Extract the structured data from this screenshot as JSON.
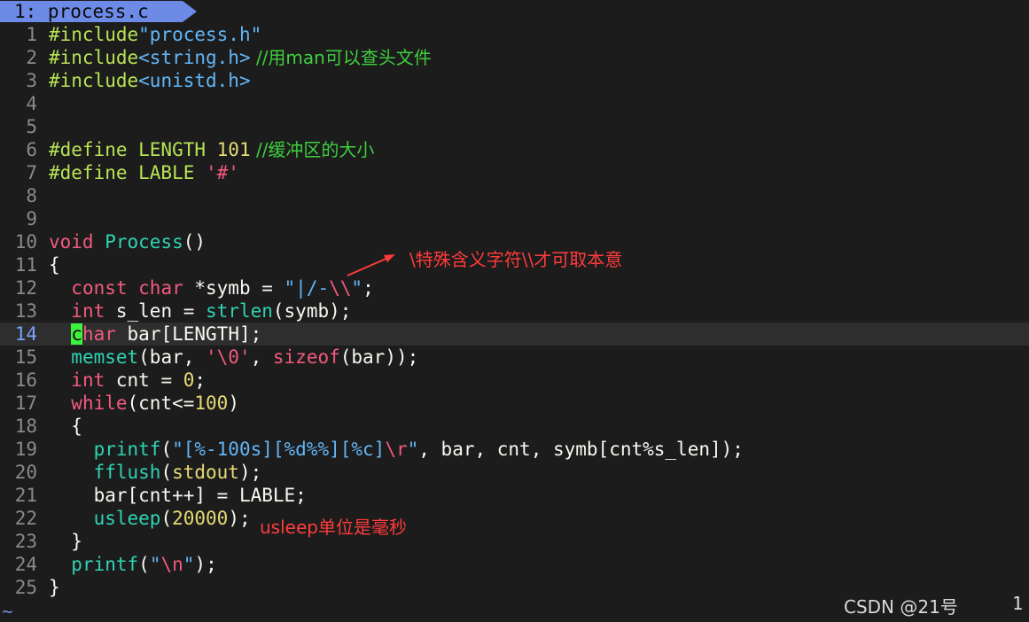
{
  "tab": {
    "label": "1: process.c"
  },
  "lines": [
    {
      "n": "1"
    },
    {
      "n": "2"
    },
    {
      "n": "3"
    },
    {
      "n": "4"
    },
    {
      "n": "5"
    },
    {
      "n": "6"
    },
    {
      "n": "7"
    },
    {
      "n": "8"
    },
    {
      "n": "9"
    },
    {
      "n": "10"
    },
    {
      "n": "11"
    },
    {
      "n": "12"
    },
    {
      "n": "13"
    },
    {
      "n": "14"
    },
    {
      "n": "15"
    },
    {
      "n": "16"
    },
    {
      "n": "17"
    },
    {
      "n": "18"
    },
    {
      "n": "19"
    },
    {
      "n": "20"
    },
    {
      "n": "21"
    },
    {
      "n": "22"
    },
    {
      "n": "23"
    },
    {
      "n": "24"
    },
    {
      "n": "25"
    }
  ],
  "code": {
    "l1_pp": "#include",
    "l1_str": "\"process.h\"",
    "l2_pp": "#include",
    "l2_str": "<string.h>",
    "l2_cm": " //用man可以查头文件",
    "l3_pp": "#include",
    "l3_str": "<unistd.h>",
    "l6_pp": "#define LENGTH ",
    "l6_num": "101",
    "l6_cm": " //缓冲区的大小",
    "l7_pp": "#define LABLE ",
    "l7_chr": "'#'",
    "l10_ty": "void",
    "l10_fn": "Process",
    "l10_rest": "()",
    "l11": "{",
    "l12_a": "const char",
    "l12_b": " *symb = ",
    "l12_s1": "\"|/-",
    "l12_esc": "\\\\",
    "l12_s2": "\"",
    "l12_c": ";",
    "l13_ty": "int",
    "l13_b": " s_len = ",
    "l13_fn": "strlen",
    "l13_c": "(symb);",
    "l14_cur": "c",
    "l14_ty": "har",
    "l14_b": " bar[LENGTH];",
    "l15_fn": "memset",
    "l15_b": "(bar, ",
    "l15_chr": "'\\0'",
    "l15_c": ", ",
    "l15_kw": "sizeof",
    "l15_d": "(bar));",
    "l16_ty": "int",
    "l16_b": " cnt = ",
    "l16_num": "0",
    "l16_c": ";",
    "l17_kw": "while",
    "l17_b": "(cnt<=",
    "l17_num": "100",
    "l17_c": ")",
    "l18": "{",
    "l19_fn": "printf",
    "l19_b": "(",
    "l19_s1": "\"[%-100s][%d%%][%c]",
    "l19_esc": "\\r",
    "l19_s2": "\"",
    "l19_c": ", bar, cnt, symb[cnt%s_len]);",
    "l20_fn": "fflush",
    "l20_b": "(",
    "l20_num": "stdout",
    "l20_c": ");",
    "l21": "bar[cnt++] = LABLE;",
    "l22_fn": "usleep",
    "l22_b": "(",
    "l22_num": "20000",
    "l22_c": ");",
    "l23": "}",
    "l24_fn": "printf",
    "l24_b": "(",
    "l24_s1": "\"",
    "l24_esc": "\\n",
    "l24_s2": "\"",
    "l24_c": ");",
    "l25": "}"
  },
  "annotations": {
    "escape_note": "\\特殊含义字符\\\\才可取本意",
    "usleep_note": "usleep单位是毫秒"
  },
  "status": {
    "tilde": "~",
    "watermark": "CSDN @21号",
    "column": "1"
  },
  "colors": {
    "background": "#1c1c1c",
    "tab": "#6c8ae6",
    "annotation": "#ff3b3b",
    "cursor": "#3cf23c"
  }
}
